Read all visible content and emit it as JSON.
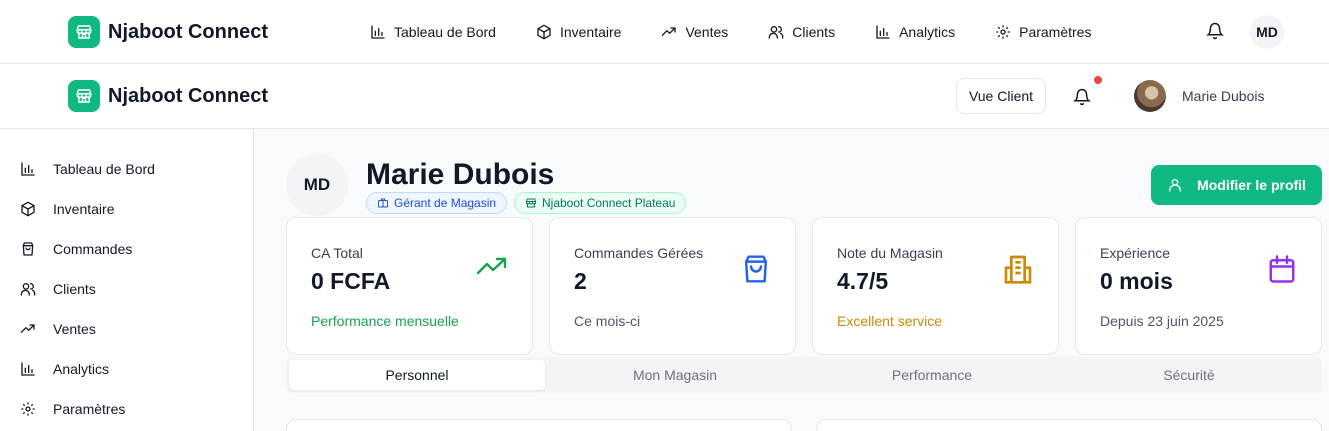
{
  "brand": {
    "name": "Njaboot Connect",
    "accent": "#10b981"
  },
  "topnav": {
    "links": [
      {
        "label": "Tableau de Bord",
        "icon": "bar-chart-icon"
      },
      {
        "label": "Inventaire",
        "icon": "box-icon"
      },
      {
        "label": "Ventes",
        "icon": "trending-up-icon"
      },
      {
        "label": "Clients",
        "icon": "users-icon"
      },
      {
        "label": "Analytics",
        "icon": "bar-chart-icon"
      },
      {
        "label": "Paramètres",
        "icon": "gear-icon"
      }
    ],
    "avatar_initials": "MD"
  },
  "header": {
    "vue_client_label": "Vue Client",
    "user_name": "Marie Dubois"
  },
  "sidebar": {
    "items": [
      {
        "label": "Tableau de Bord",
        "icon": "bar-chart-icon"
      },
      {
        "label": "Inventaire",
        "icon": "box-icon"
      },
      {
        "label": "Commandes",
        "icon": "shopping-bag-icon"
      },
      {
        "label": "Clients",
        "icon": "users-icon"
      },
      {
        "label": "Ventes",
        "icon": "trending-up-icon"
      },
      {
        "label": "Analytics",
        "icon": "bar-chart-icon"
      },
      {
        "label": "Paramètres",
        "icon": "gear-icon"
      }
    ]
  },
  "profile": {
    "initials": "MD",
    "name": "Marie Dubois",
    "role_badge": "Gérant de Magasin",
    "store_badge": "Njaboot Connect Plateau",
    "edit_label": "Modifier le profil"
  },
  "stats": [
    {
      "label": "CA Total",
      "value": "0 FCFA",
      "sub": "Performance mensuelle",
      "sub_color": "#16a34a",
      "icon": "trending-up-icon",
      "icon_color": "#16a34a"
    },
    {
      "label": "Commandes Gérées",
      "value": "2",
      "sub": "Ce mois-ci",
      "sub_color": "#4b5563",
      "icon": "shopping-bag-icon",
      "icon_color": "#2563eb"
    },
    {
      "label": "Note du Magasin",
      "value": "4.7/5",
      "sub": "Excellent service",
      "sub_color": "#ca8a04",
      "icon": "building-icon",
      "icon_color": "#ca8a04"
    },
    {
      "label": "Expérience",
      "value": "0 mois",
      "sub": "Depuis 23 juin 2025",
      "sub_color": "#4b5563",
      "icon": "calendar-icon",
      "icon_color": "#9333ea"
    }
  ],
  "tabs": [
    {
      "label": "Personnel",
      "active": true
    },
    {
      "label": "Mon Magasin",
      "active": false
    },
    {
      "label": "Performance",
      "active": false
    },
    {
      "label": "Sécurité",
      "active": false
    }
  ]
}
